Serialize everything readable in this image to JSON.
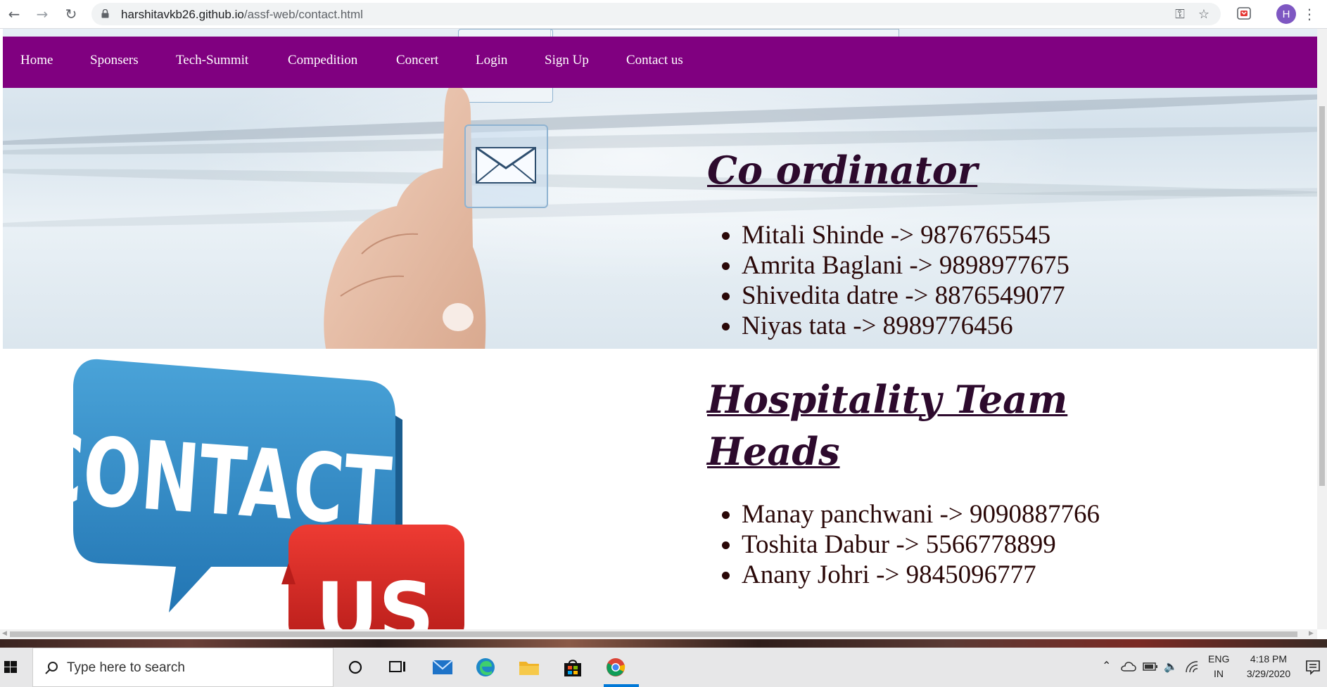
{
  "browser": {
    "url_host": "harshitavkb26.github.io",
    "url_path": "/assf-web/contact.html",
    "profile_initial": "H"
  },
  "nav": {
    "items": [
      {
        "label": "Home"
      },
      {
        "label": "Sponsers"
      },
      {
        "label": "Tech-Summit"
      },
      {
        "label": "Compedition"
      },
      {
        "label": "Concert"
      },
      {
        "label": "Login"
      },
      {
        "label": "Sign Up"
      },
      {
        "label": "Contact us"
      }
    ],
    "background": "#800080"
  },
  "coordinators": {
    "title": "Co ordinator",
    "people": [
      "Mitali Shinde -> 9876765545",
      "Amrita Baglani -> 9898977675",
      "Shivedita datre -> 8876549077",
      "Niyas tata -> 8989776456"
    ]
  },
  "hospitality": {
    "title_line1": "Hospitality Team",
    "title_line2": "Heads",
    "people": [
      "Manay panchwani -> 9090887766",
      "Toshita Dabur -> 5566778899",
      "Anany Johri -> 9845096777"
    ]
  },
  "graphic": {
    "word1": "CONTACT",
    "word2": "US"
  },
  "taskbar": {
    "search_placeholder": "Type here to search",
    "lang_line1": "ENG",
    "lang_line2": "IN",
    "time": "4:18 PM",
    "date": "3/29/2020"
  }
}
